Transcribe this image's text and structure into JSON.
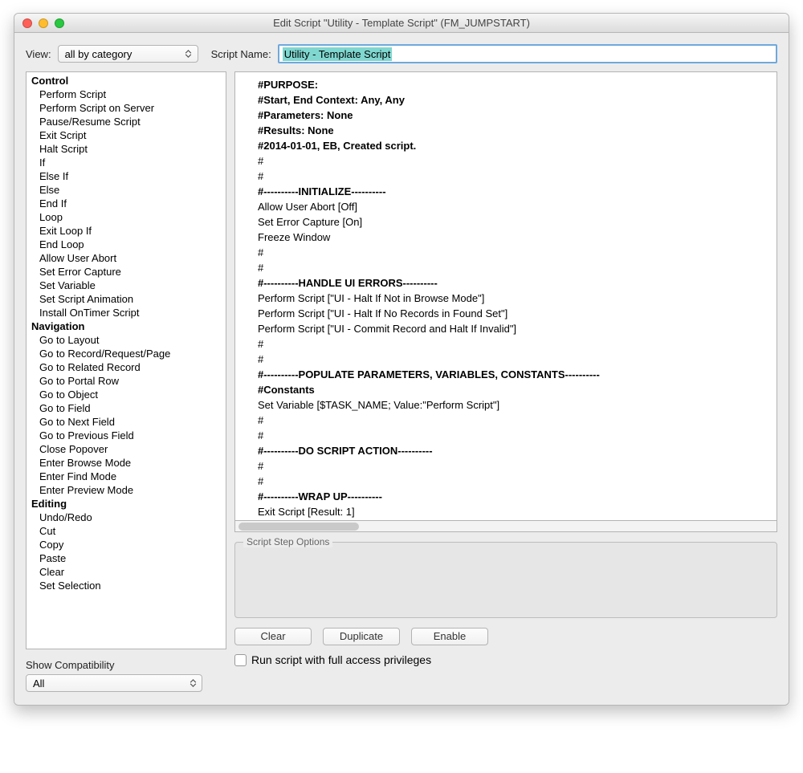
{
  "window": {
    "title": "Edit Script \"Utility - Template Script\" (FM_JUMPSTART)"
  },
  "toolbar": {
    "view_label": "View:",
    "view_value": "all by category",
    "script_name_label": "Script Name:",
    "script_name_value": "Utility - Template Script"
  },
  "step_list": [
    {
      "type": "cat",
      "text": "Control"
    },
    {
      "type": "item",
      "text": "Perform Script"
    },
    {
      "type": "item",
      "text": "Perform Script on Server"
    },
    {
      "type": "item",
      "text": "Pause/Resume Script"
    },
    {
      "type": "item",
      "text": "Exit Script"
    },
    {
      "type": "item",
      "text": "Halt Script"
    },
    {
      "type": "item",
      "text": "If"
    },
    {
      "type": "item",
      "text": "Else If"
    },
    {
      "type": "item",
      "text": "Else"
    },
    {
      "type": "item",
      "text": "End If"
    },
    {
      "type": "item",
      "text": "Loop"
    },
    {
      "type": "item",
      "text": "Exit Loop If"
    },
    {
      "type": "item",
      "text": "End Loop"
    },
    {
      "type": "item",
      "text": "Allow User Abort"
    },
    {
      "type": "item",
      "text": "Set Error Capture"
    },
    {
      "type": "item",
      "text": "Set Variable"
    },
    {
      "type": "item",
      "text": "Set Script Animation"
    },
    {
      "type": "item",
      "text": "Install OnTimer Script"
    },
    {
      "type": "cat",
      "text": "Navigation"
    },
    {
      "type": "item",
      "text": "Go to Layout"
    },
    {
      "type": "item",
      "text": "Go to Record/Request/Page"
    },
    {
      "type": "item",
      "text": "Go to Related Record"
    },
    {
      "type": "item",
      "text": "Go to Portal Row"
    },
    {
      "type": "item",
      "text": "Go to Object"
    },
    {
      "type": "item",
      "text": "Go to Field"
    },
    {
      "type": "item",
      "text": "Go to Next Field"
    },
    {
      "type": "item",
      "text": "Go to Previous Field"
    },
    {
      "type": "item",
      "text": "Close Popover"
    },
    {
      "type": "item",
      "text": "Enter Browse Mode"
    },
    {
      "type": "item",
      "text": "Enter Find Mode"
    },
    {
      "type": "item",
      "text": "Enter Preview Mode"
    },
    {
      "type": "cat",
      "text": "Editing"
    },
    {
      "type": "item",
      "text": "Undo/Redo"
    },
    {
      "type": "item",
      "text": "Cut"
    },
    {
      "type": "item",
      "text": "Copy"
    },
    {
      "type": "item",
      "text": "Paste"
    },
    {
      "type": "item",
      "text": "Clear"
    },
    {
      "type": "item",
      "text": "Set Selection"
    }
  ],
  "script_lines": [
    {
      "bold": true,
      "text": "#PURPOSE:"
    },
    {
      "bold": true,
      "text": "#Start, End Context: Any, Any"
    },
    {
      "bold": true,
      "text": "#Parameters: None"
    },
    {
      "bold": true,
      "text": "#Results: None"
    },
    {
      "bold": true,
      "text": "#2014-01-01, EB, Created script."
    },
    {
      "bold": false,
      "text": "#"
    },
    {
      "bold": false,
      "text": "#"
    },
    {
      "bold": true,
      "text": "#----------INITIALIZE----------"
    },
    {
      "bold": false,
      "text": "Allow User Abort [Off]"
    },
    {
      "bold": false,
      "text": "Set Error Capture [On]"
    },
    {
      "bold": false,
      "text": "Freeze Window"
    },
    {
      "bold": false,
      "text": "#"
    },
    {
      "bold": false,
      "text": "#"
    },
    {
      "bold": true,
      "text": "#----------HANDLE UI ERRORS----------"
    },
    {
      "bold": false,
      "text": "Perform Script [\"UI - Halt If Not in Browse Mode\"]"
    },
    {
      "bold": false,
      "text": "Perform Script [\"UI - Halt If No Records in Found Set\"]"
    },
    {
      "bold": false,
      "text": "Perform Script [\"UI - Commit Record and Halt If Invalid\"]"
    },
    {
      "bold": false,
      "text": "#"
    },
    {
      "bold": false,
      "text": "#"
    },
    {
      "bold": true,
      "text": "#----------POPULATE PARAMETERS, VARIABLES, CONSTANTS----------"
    },
    {
      "bold": true,
      "text": "#Constants"
    },
    {
      "bold": false,
      "text": "Set Variable [$TASK_NAME; Value:\"Perform Script\"]"
    },
    {
      "bold": false,
      "text": "#"
    },
    {
      "bold": false,
      "text": "#"
    },
    {
      "bold": true,
      "text": "#----------DO SCRIPT ACTION----------"
    },
    {
      "bold": false,
      "text": "#"
    },
    {
      "bold": false,
      "text": "#"
    },
    {
      "bold": true,
      "text": "#----------WRAP UP----------"
    },
    {
      "bold": false,
      "text": "Exit Script [Result: 1]"
    }
  ],
  "options_panel": {
    "legend": "Script Step Options"
  },
  "compat": {
    "label": "Show Compatibility",
    "value": "All"
  },
  "buttons": {
    "clear": "Clear",
    "duplicate": "Duplicate",
    "enable": "Enable"
  },
  "checkbox": {
    "label": "Run script with full access privileges"
  }
}
